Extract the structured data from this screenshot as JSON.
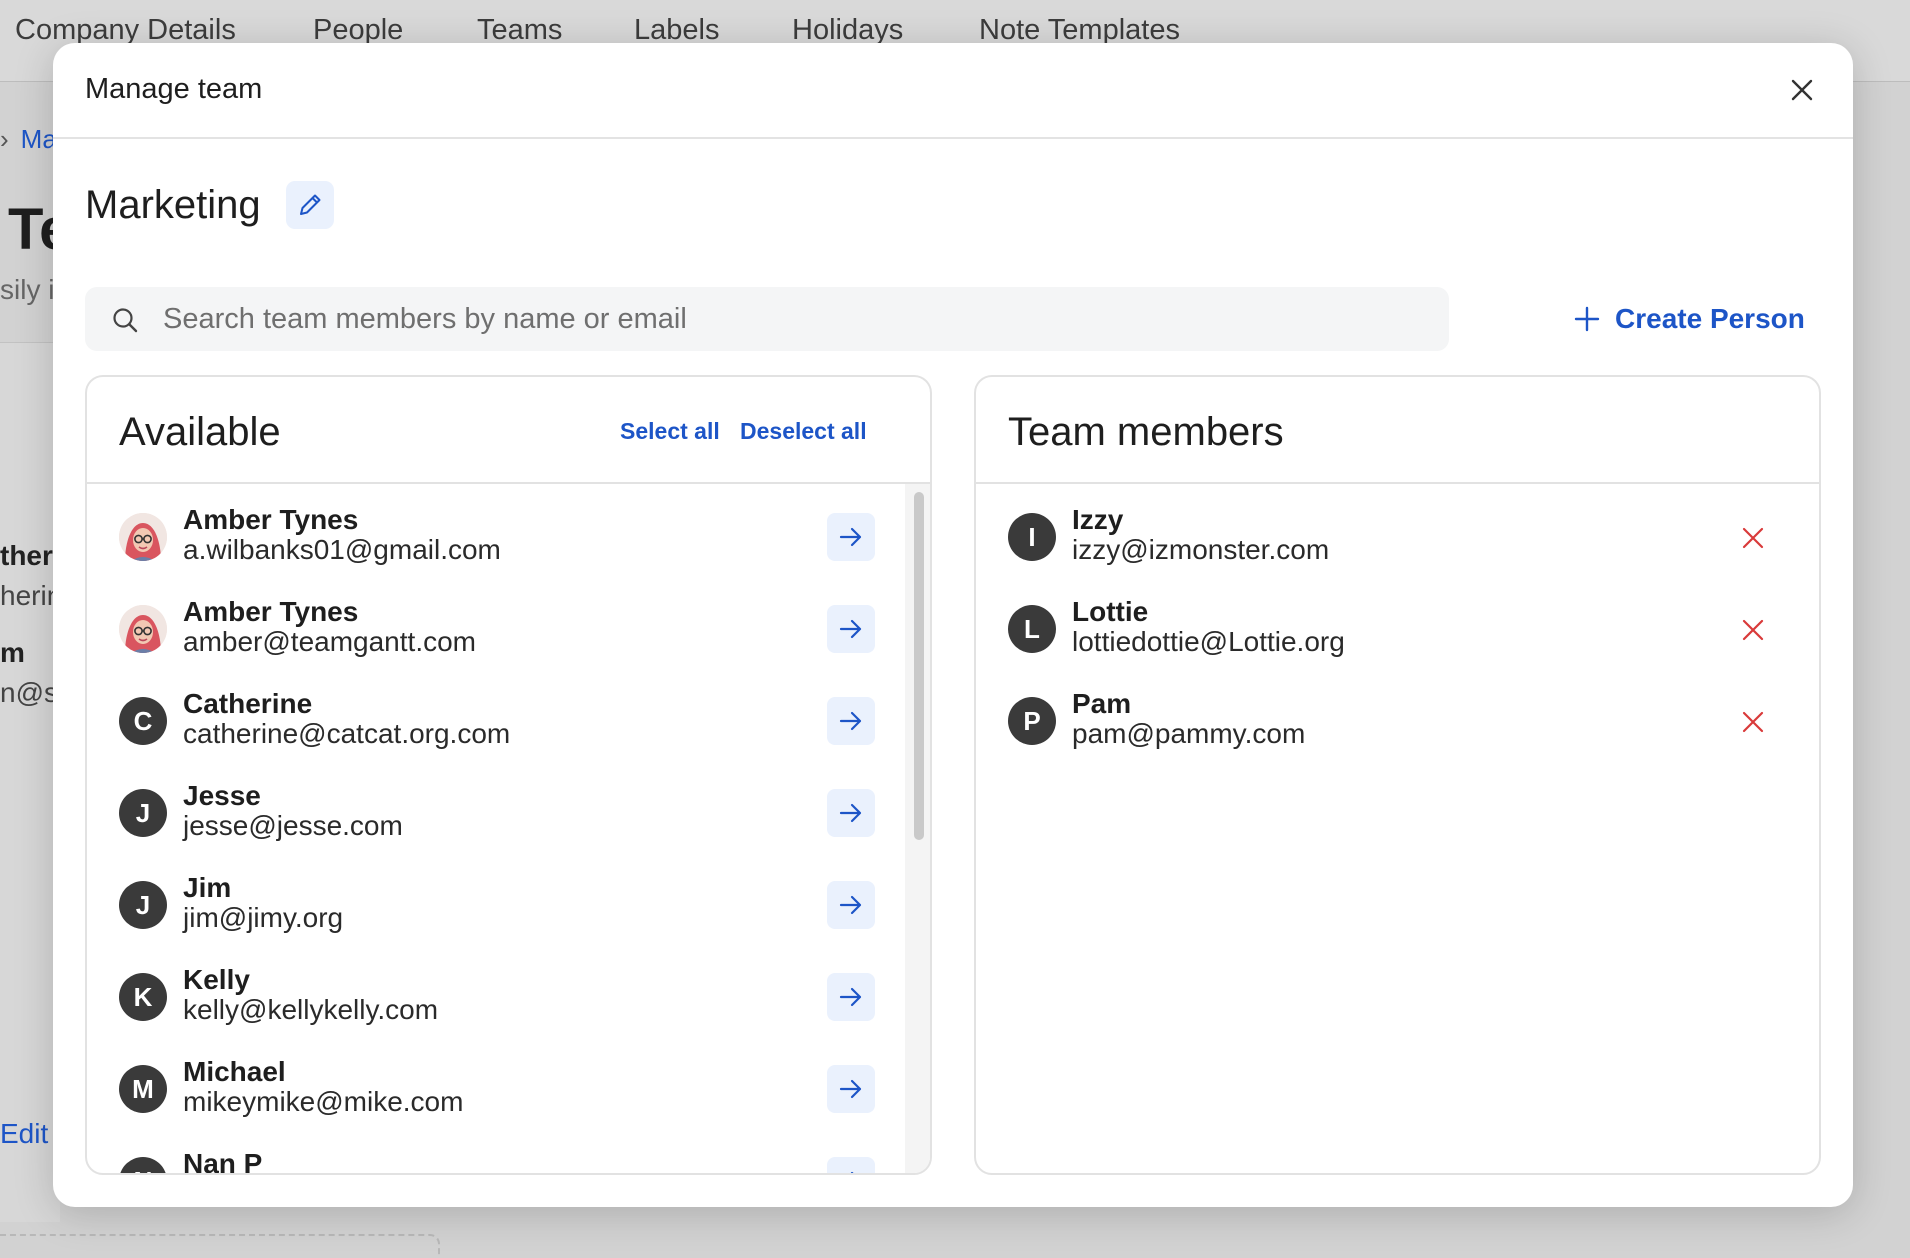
{
  "background": {
    "nav_tabs": [
      "Company Details",
      "People",
      "Teams",
      "Labels",
      "Holidays",
      "Note Templates"
    ],
    "breadcrumb": "Ma",
    "page_title": "Te",
    "subtitle": "sily i",
    "card_lines": [
      "ther",
      "herin",
      "m",
      "n@sa"
    ],
    "edit_link": "Edit T"
  },
  "modal": {
    "title": "Manage team",
    "team_name": "Marketing",
    "search": {
      "placeholder": "Search team members by name or email",
      "value": ""
    },
    "create_person_label": "Create Person",
    "available": {
      "title": "Available",
      "select_all": "Select all",
      "deselect_all": "Deselect all",
      "people": [
        {
          "name": "Amber Tynes",
          "email": "a.wilbanks01@gmail.com",
          "initial": "",
          "avatar": "photo"
        },
        {
          "name": "Amber Tynes",
          "email": "amber@teamgantt.com",
          "initial": "",
          "avatar": "photo"
        },
        {
          "name": "Catherine",
          "email": "catherine@catcat.org.com",
          "initial": "C",
          "avatar": "initial"
        },
        {
          "name": "Jesse",
          "email": "jesse@jesse.com",
          "initial": "J",
          "avatar": "initial"
        },
        {
          "name": "Jim",
          "email": "jim@jimy.org",
          "initial": "J",
          "avatar": "initial"
        },
        {
          "name": "Kelly",
          "email": "kelly@kellykelly.com",
          "initial": "K",
          "avatar": "initial"
        },
        {
          "name": "Michael",
          "email": "mikeymike@mike.com",
          "initial": "M",
          "avatar": "initial"
        },
        {
          "name": "Nan P",
          "email": "",
          "initial": "N",
          "avatar": "initial"
        }
      ]
    },
    "members": {
      "title": "Team members",
      "people": [
        {
          "name": "Izzy",
          "email": "izzy@izmonster.com",
          "initial": "I"
        },
        {
          "name": "Lottie",
          "email": "lottiedottie@Lottie.org",
          "initial": "L"
        },
        {
          "name": "Pam",
          "email": "pam@pammy.com",
          "initial": "P"
        }
      ]
    },
    "icons": {
      "close": "close-icon",
      "edit": "pencil-icon",
      "search": "search-icon",
      "create": "plus-icon",
      "add": "arrow-right-icon",
      "remove": "x-icon"
    },
    "colors": {
      "accent": "#1d55c7",
      "remove": "#d93a3a",
      "avatar": "#3a3a3a",
      "button_bg": "#eaf1fd"
    }
  }
}
